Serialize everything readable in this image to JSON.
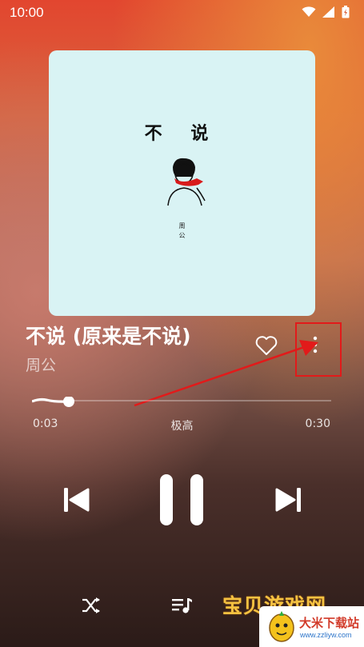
{
  "status": {
    "time": "10:00"
  },
  "cover": {
    "title": "不 说",
    "artist_line1": "周",
    "artist_line2": "公"
  },
  "song": {
    "title": "不说 (原来是不说)",
    "artist": "周公"
  },
  "player": {
    "current_time": "0:03",
    "total_time": "0:30",
    "quality": "极高",
    "progress_fraction": 0.1
  },
  "watermark": {
    "text": "宝贝游戏网",
    "site_name": "大米下载站",
    "site_url": "www.zzliyw.com"
  },
  "colors": {
    "highlight": "#e21a1a",
    "cover_bg": "#d9f3f4"
  }
}
